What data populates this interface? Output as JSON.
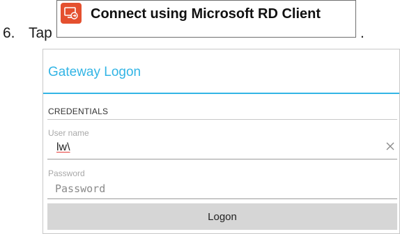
{
  "step": {
    "number": "6.",
    "verb": "Tap",
    "button_label": "Connect using Microsoft RD Client",
    "button_icon": "remote-desktop-icon",
    "trailing": "."
  },
  "dialog": {
    "title": "Gateway Logon",
    "section_heading": "CREDENTIALS",
    "username": {
      "caption": "User name",
      "value": "lw\\",
      "clear_icon": "close-icon"
    },
    "password": {
      "caption": "Password",
      "placeholder": "Password"
    },
    "logon_label": "Logon"
  },
  "colors": {
    "accent": "#33b5e5",
    "icon_background": "#e4502f",
    "button_background": "#d6d6d6"
  }
}
